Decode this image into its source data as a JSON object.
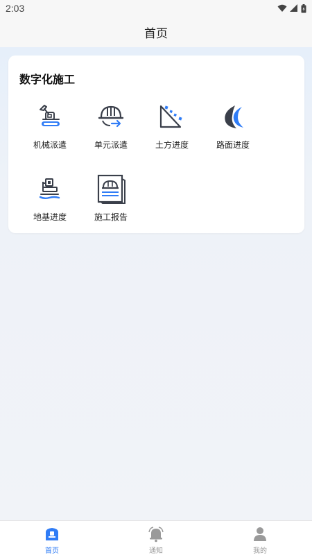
{
  "status_bar": {
    "time": "2:03"
  },
  "header": {
    "title": "首页"
  },
  "card": {
    "title": "数字化施工",
    "items": [
      {
        "label": "机械派遣",
        "icon": "excavator-icon"
      },
      {
        "label": "单元派遣",
        "icon": "helmet-icon"
      },
      {
        "label": "土方进度",
        "icon": "earthwork-slope-icon"
      },
      {
        "label": "路面进度",
        "icon": "road-curve-icon"
      },
      {
        "label": "地基进度",
        "icon": "foundation-icon"
      },
      {
        "label": "施工报告",
        "icon": "report-document-icon"
      }
    ]
  },
  "tabbar": {
    "items": [
      {
        "label": "首页",
        "icon": "home-icon",
        "active": true
      },
      {
        "label": "通知",
        "icon": "bell-icon",
        "active": false
      },
      {
        "label": "我的",
        "icon": "user-icon",
        "active": false
      }
    ]
  },
  "colors": {
    "accent": "#2f7cf6",
    "icon_dark": "#3a3f4a",
    "tab_inactive": "#9a9a9a"
  }
}
